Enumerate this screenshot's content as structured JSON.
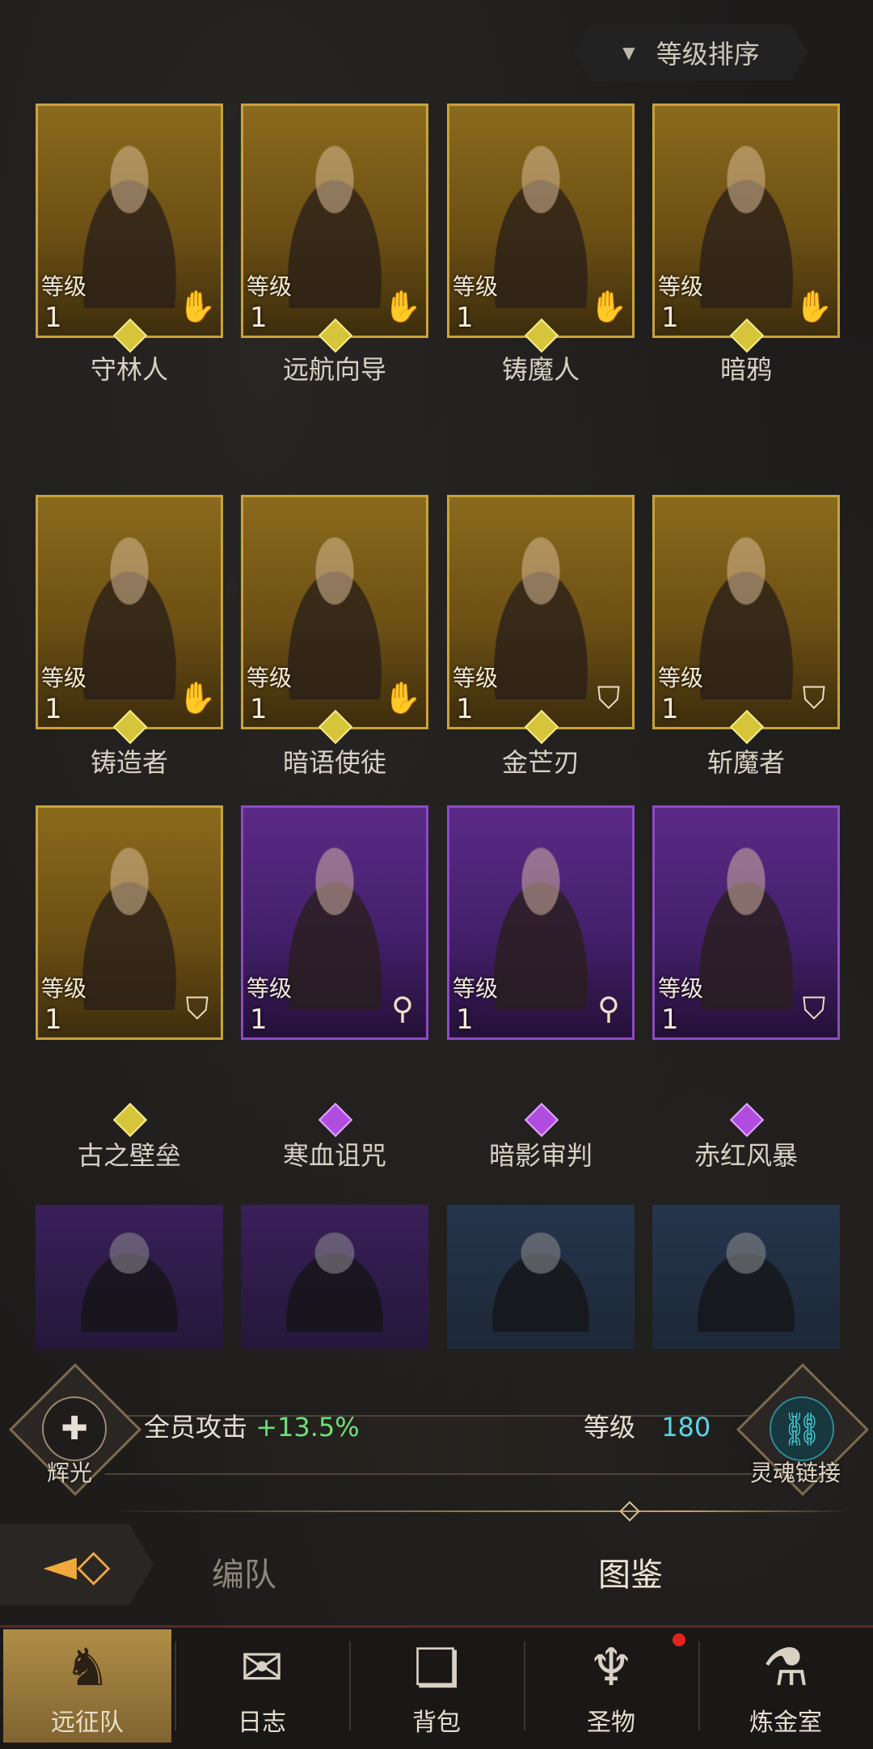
{
  "sort_button": {
    "label": "等级排序"
  },
  "heroes": [
    {
      "name": "守林人",
      "level_label": "等级",
      "level": "1",
      "rarity": "gold",
      "class_icon": "hand-icon"
    },
    {
      "name": "远航向导",
      "level_label": "等级",
      "level": "1",
      "rarity": "gold",
      "class_icon": "hand-icon"
    },
    {
      "name": "铸魔人",
      "level_label": "等级",
      "level": "1",
      "rarity": "gold",
      "class_icon": "hand-icon"
    },
    {
      "name": "暗鸦",
      "level_label": "等级",
      "level": "1",
      "rarity": "gold",
      "class_icon": "hand-icon"
    },
    {
      "name": "铸造者",
      "level_label": "等级",
      "level": "1",
      "rarity": "gold",
      "class_icon": "hand-icon"
    },
    {
      "name": "暗语使徒",
      "level_label": "等级",
      "level": "1",
      "rarity": "gold",
      "class_icon": "hand-icon"
    },
    {
      "name": "金芒刃",
      "level_label": "等级",
      "level": "1",
      "rarity": "gold",
      "class_icon": "shield-icon"
    },
    {
      "name": "斩魔者",
      "level_label": "等级",
      "level": "1",
      "rarity": "gold",
      "class_icon": "shield-icon"
    },
    {
      "name": "古之壁垒",
      "level_label": "等级",
      "level": "1",
      "rarity": "gold",
      "class_icon": "shield-icon"
    },
    {
      "name": "寒血诅咒",
      "level_label": "等级",
      "level": "1",
      "rarity": "purple",
      "class_icon": "staff-icon"
    },
    {
      "name": "暗影审判",
      "level_label": "等级",
      "level": "1",
      "rarity": "purple",
      "class_icon": "staff-icon"
    },
    {
      "name": "赤红风暴",
      "level_label": "等级",
      "level": "1",
      "rarity": "purple",
      "class_icon": "shield-icon"
    }
  ],
  "partial_heroes": [
    {
      "rarity": "purple",
      "portrait": "bear-hood-warrior"
    },
    {
      "rarity": "purple",
      "portrait": "knight-helmet"
    },
    {
      "rarity": "blue",
      "portrait": "eyepatch-man"
    },
    {
      "rarity": "blue",
      "portrait": "armored-knight"
    }
  ],
  "bonus": {
    "left_emblem_label": "辉光",
    "attack_label": "全员攻击",
    "attack_value": "+13.5%",
    "level_label": "等级",
    "level_value": "180",
    "right_emblem_label": "灵魂链接"
  },
  "tabs": [
    {
      "label": "编队",
      "active": false
    },
    {
      "label": "图鉴",
      "active": true
    }
  ],
  "bottom_nav": [
    {
      "label": "远征队",
      "icon": "horned-helmet-icon",
      "active": true
    },
    {
      "label": "日志",
      "icon": "scroll-icon",
      "active": false
    },
    {
      "label": "背包",
      "icon": "bag-icon",
      "active": false
    },
    {
      "label": "圣物",
      "icon": "chalice-icon",
      "active": false
    },
    {
      "label": "炼金室",
      "icon": "alchemy-icon",
      "active": false
    }
  ],
  "colors": {
    "gold_border": "#c9a23a",
    "purple_border": "#8e49c9",
    "bonus_green": "#6ee07a",
    "level_cyan": "#58d7e6",
    "notification": "#e0231f"
  }
}
